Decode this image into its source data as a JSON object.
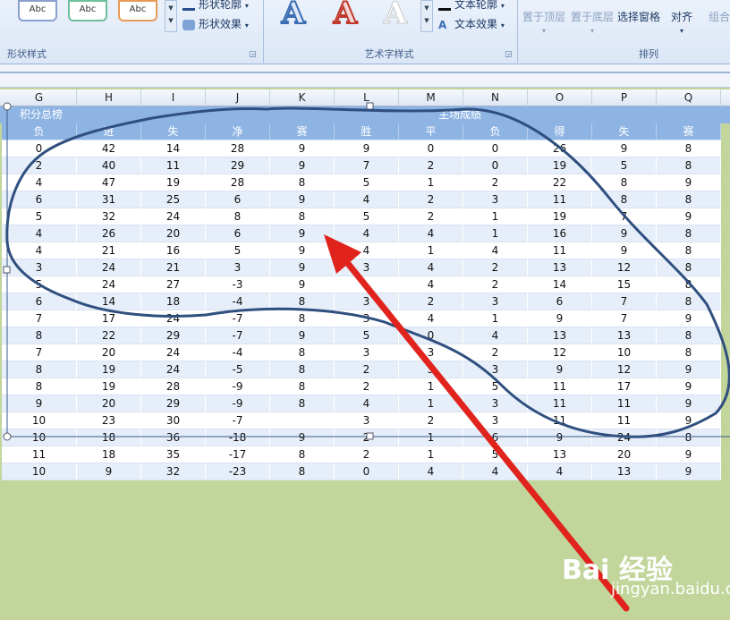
{
  "ribbon": {
    "shape_styles": {
      "sample_labels": [
        "Abc",
        "Abc",
        "Abc"
      ],
      "outline_label": "形状轮廓",
      "effects_label": "形状效果",
      "group_label": "形状样式"
    },
    "wordart_styles": {
      "sample_letters": [
        "A",
        "A",
        "A"
      ],
      "outline_label": "文本轮廓",
      "effects_label": "文本效果",
      "group_label": "艺术字样式"
    },
    "arrange": {
      "bring_front_label": "置于顶层",
      "send_back_label": "置于底层",
      "selection_pane_label": "选择窗格",
      "align_label": "对齐",
      "group_label_cmd": "组合",
      "group_label": "排列"
    }
  },
  "columns": [
    "G",
    "H",
    "I",
    "J",
    "K",
    "L",
    "M",
    "N",
    "O",
    "P",
    "Q"
  ],
  "sheet": {
    "title_left": "积分总榜",
    "title_right": "主场成绩",
    "headers": [
      "负",
      "进",
      "失",
      "净",
      "赛",
      "胜",
      "平",
      "负",
      "得",
      "失",
      "赛"
    ],
    "rows": [
      [
        "0",
        "42",
        "14",
        "28",
        "9",
        "9",
        "0",
        "0",
        "26",
        "9",
        "8"
      ],
      [
        "2",
        "40",
        "11",
        "29",
        "9",
        "7",
        "2",
        "0",
        "19",
        "5",
        "8"
      ],
      [
        "4",
        "47",
        "19",
        "28",
        "8",
        "5",
        "1",
        "2",
        "22",
        "8",
        "9"
      ],
      [
        "6",
        "31",
        "25",
        "6",
        "9",
        "4",
        "2",
        "3",
        "11",
        "8",
        "8"
      ],
      [
        "5",
        "32",
        "24",
        "8",
        "8",
        "5",
        "2",
        "1",
        "19",
        "7",
        "9"
      ],
      [
        "4",
        "26",
        "20",
        "6",
        "9",
        "4",
        "4",
        "1",
        "16",
        "9",
        "8"
      ],
      [
        "4",
        "21",
        "16",
        "5",
        "9",
        "4",
        "1",
        "4",
        "11",
        "9",
        "8"
      ],
      [
        "3",
        "24",
        "21",
        "3",
        "9",
        "3",
        "4",
        "2",
        "13",
        "12",
        "8"
      ],
      [
        "5",
        "24",
        "27",
        "-3",
        "9",
        "",
        "4",
        "2",
        "14",
        "15",
        "8"
      ],
      [
        "6",
        "14",
        "18",
        "-4",
        "8",
        "3",
        "2",
        "3",
        "6",
        "7",
        "8"
      ],
      [
        "7",
        "17",
        "24",
        "-7",
        "8",
        "3",
        "4",
        "1",
        "9",
        "7",
        "9"
      ],
      [
        "8",
        "22",
        "29",
        "-7",
        "9",
        "5",
        "0",
        "4",
        "13",
        "13",
        "8"
      ],
      [
        "7",
        "20",
        "24",
        "-4",
        "8",
        "3",
        "3",
        "2",
        "12",
        "10",
        "8"
      ],
      [
        "8",
        "19",
        "24",
        "-5",
        "8",
        "2",
        "3",
        "3",
        "9",
        "12",
        "9"
      ],
      [
        "8",
        "19",
        "28",
        "-9",
        "8",
        "2",
        "1",
        "5",
        "11",
        "17",
        "9"
      ],
      [
        "9",
        "20",
        "29",
        "-9",
        "8",
        "4",
        "1",
        "3",
        "11",
        "11",
        "9"
      ],
      [
        "10",
        "23",
        "30",
        "-7",
        "",
        "3",
        "2",
        "3",
        "11",
        "11",
        "9"
      ],
      [
        "10",
        "18",
        "36",
        "-18",
        "9",
        "2",
        "1",
        "6",
        "9",
        "24",
        "8"
      ],
      [
        "11",
        "18",
        "35",
        "-17",
        "8",
        "2",
        "1",
        "5",
        "13",
        "20",
        "9"
      ],
      [
        "10",
        "9",
        "32",
        "-23",
        "8",
        "0",
        "4",
        "4",
        "4",
        "13",
        "9"
      ]
    ]
  },
  "watermark": {
    "logo": "Bai 经验",
    "url": "jingyan.baidu.com"
  },
  "colors": {
    "header_blue": "#8eb4e3",
    "zebra_light": "#e6eef9",
    "annotation_ink": "#2f4f7f",
    "arrow_red": "#e0231c",
    "background_green": "#c2d69b"
  }
}
